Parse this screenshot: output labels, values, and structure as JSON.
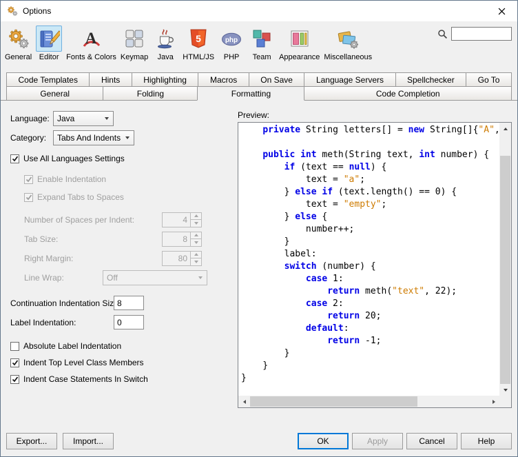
{
  "window": {
    "title": "Options"
  },
  "colors": {
    "selected_tool_bg": "#cbe8f6",
    "selected_tool_border": "#70b0e0",
    "default_button_border": "#0078d7"
  },
  "toolbar": {
    "items": [
      {
        "label": "General",
        "icon": "gears-icon",
        "selected": false
      },
      {
        "label": "Editor",
        "icon": "editor-icon",
        "selected": true
      },
      {
        "label": "Fonts & Colors",
        "icon": "fonts-colors-icon",
        "selected": false
      },
      {
        "label": "Keymap",
        "icon": "keymap-icon",
        "selected": false
      },
      {
        "label": "Java",
        "icon": "java-cup-icon",
        "selected": false
      },
      {
        "label": "HTML/JS",
        "icon": "html5-icon",
        "selected": false
      },
      {
        "label": "PHP",
        "icon": "php-icon",
        "selected": false
      },
      {
        "label": "Team",
        "icon": "team-cubes-icon",
        "selected": false
      },
      {
        "label": "Appearance",
        "icon": "appearance-icon",
        "selected": false
      },
      {
        "label": "Miscellaneous",
        "icon": "miscellaneous-icon",
        "selected": false
      }
    ],
    "search": {
      "value": ""
    }
  },
  "tabs": {
    "row1": [
      "Code Templates",
      "Hints",
      "Highlighting",
      "Macros",
      "On Save",
      "Language Servers",
      "Spellchecker",
      "Go To"
    ],
    "row2": [
      {
        "label": "General",
        "active": false
      },
      {
        "label": "Folding",
        "active": false
      },
      {
        "label": "Formatting",
        "active": true
      },
      {
        "label": "Code Completion",
        "active": false
      }
    ]
  },
  "form": {
    "language": {
      "label": "Language:",
      "value": "Java"
    },
    "category": {
      "label": "Category:",
      "value": "Tabs And Indents"
    },
    "use_all_languages": {
      "label": "Use All Languages Settings",
      "checked": true,
      "disabled": false
    },
    "enable_indentation": {
      "label": "Enable Indentation",
      "checked": true,
      "disabled": true
    },
    "expand_tabs": {
      "label": "Expand Tabs to Spaces",
      "checked": true,
      "disabled": true
    },
    "spaces_per_indent": {
      "label": "Number of Spaces per Indent:",
      "value": "4",
      "disabled": true
    },
    "tab_size": {
      "label": "Tab Size:",
      "value": "8",
      "disabled": true
    },
    "right_margin": {
      "label": "Right Margin:",
      "value": "80",
      "disabled": true
    },
    "line_wrap": {
      "label": "Line Wrap:",
      "value": "Off",
      "disabled": true
    },
    "continuation_indent": {
      "label": "Continuation Indentation Size:",
      "value": "8"
    },
    "label_indent": {
      "label": "Label Indentation:",
      "value": "0"
    },
    "absolute_label_indent": {
      "label": "Absolute Label Indentation",
      "checked": false,
      "disabled": false
    },
    "indent_top_level": {
      "label": "Indent Top Level Class Members",
      "checked": true,
      "disabled": false
    },
    "indent_case": {
      "label": "Indent Case Statements In Switch",
      "checked": true,
      "disabled": false
    }
  },
  "preview": {
    "label": "Preview:",
    "colors": {
      "keyword": "#0000e6",
      "string": "#ce7b00",
      "plain": "#000000"
    },
    "code_lines": [
      [
        [
          "p",
          "    "
        ],
        [
          "k",
          "private"
        ],
        [
          "p",
          " String letters[] = "
        ],
        [
          "k",
          "new"
        ],
        [
          "p",
          " String[]{"
        ],
        [
          "s",
          "\"A\""
        ],
        [
          "p",
          ","
        ]
      ],
      [],
      [
        [
          "p",
          "    "
        ],
        [
          "k",
          "public"
        ],
        [
          "p",
          " "
        ],
        [
          "k",
          "int"
        ],
        [
          "p",
          " meth(String text, "
        ],
        [
          "k",
          "int"
        ],
        [
          "p",
          " number) {"
        ]
      ],
      [
        [
          "p",
          "        "
        ],
        [
          "k",
          "if"
        ],
        [
          "p",
          " (text == "
        ],
        [
          "k",
          "null"
        ],
        [
          "p",
          ") {"
        ]
      ],
      [
        [
          "p",
          "            text = "
        ],
        [
          "s",
          "\"a\""
        ],
        [
          "p",
          ";"
        ]
      ],
      [
        [
          "p",
          "        } "
        ],
        [
          "k",
          "else"
        ],
        [
          "p",
          " "
        ],
        [
          "k",
          "if"
        ],
        [
          "p",
          " (text.length() == 0) {"
        ]
      ],
      [
        [
          "p",
          "            text = "
        ],
        [
          "s",
          "\"empty\""
        ],
        [
          "p",
          ";"
        ]
      ],
      [
        [
          "p",
          "        } "
        ],
        [
          "k",
          "else"
        ],
        [
          "p",
          " {"
        ]
      ],
      [
        [
          "p",
          "            number++;"
        ]
      ],
      [
        [
          "p",
          "        }"
        ]
      ],
      [
        [
          "p",
          "        label:"
        ]
      ],
      [
        [
          "p",
          "        "
        ],
        [
          "k",
          "switch"
        ],
        [
          "p",
          " (number) {"
        ]
      ],
      [
        [
          "p",
          "            "
        ],
        [
          "k",
          "case"
        ],
        [
          "p",
          " 1:"
        ]
      ],
      [
        [
          "p",
          "                "
        ],
        [
          "k",
          "return"
        ],
        [
          "p",
          " meth("
        ],
        [
          "s",
          "\"text\""
        ],
        [
          "p",
          ", 22);"
        ]
      ],
      [
        [
          "p",
          "            "
        ],
        [
          "k",
          "case"
        ],
        [
          "p",
          " 2:"
        ]
      ],
      [
        [
          "p",
          "                "
        ],
        [
          "k",
          "return"
        ],
        [
          "p",
          " 20;"
        ]
      ],
      [
        [
          "p",
          "            "
        ],
        [
          "k",
          "default"
        ],
        [
          "p",
          ":"
        ]
      ],
      [
        [
          "p",
          "                "
        ],
        [
          "k",
          "return"
        ],
        [
          "p",
          " -1;"
        ]
      ],
      [
        [
          "p",
          "        }"
        ]
      ],
      [
        [
          "p",
          "    }"
        ]
      ],
      [
        [
          "p",
          "}"
        ]
      ]
    ]
  },
  "buttons": {
    "export": "Export...",
    "import": "Import...",
    "ok": "OK",
    "apply": "Apply",
    "cancel": "Cancel",
    "help": "Help"
  }
}
